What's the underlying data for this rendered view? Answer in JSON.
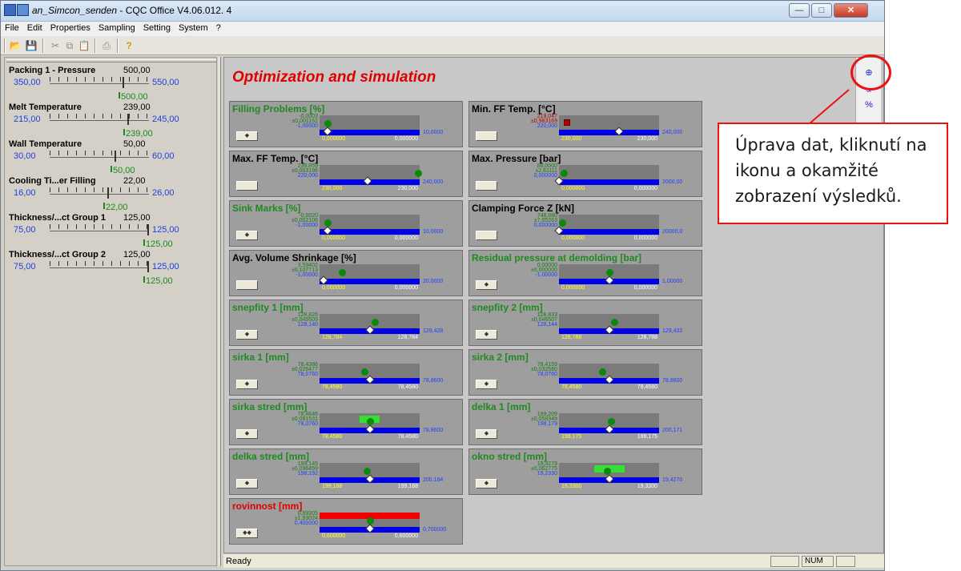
{
  "window": {
    "title_italic": "an_Simcon_senden",
    "title_rest": " - CQC Office V4.06.012. 4",
    "minimize": "—",
    "maximize": "□",
    "close": "✕"
  },
  "menu": [
    "File",
    "Edit",
    "Properties",
    "Sampling",
    "Setting",
    "System",
    "?"
  ],
  "toolbar_icons": [
    "open-folder-icon",
    "save-icon",
    "cut-icon",
    "copy-icon",
    "paste-icon",
    "print-icon",
    "help-icon"
  ],
  "params": [
    {
      "name": "Packing 1 - Pressure",
      "value": "500,00",
      "min": "350,00",
      "max": "550,00",
      "current": "500,00",
      "pos": 0.75
    },
    {
      "name": "Melt Temperature",
      "value": "239,00",
      "min": "215,00",
      "max": "245,00",
      "current": "239,00",
      "pos": 0.8
    },
    {
      "name": "Wall Temperature",
      "value": "50,00",
      "min": "30,00",
      "max": "60,00",
      "current": "50,00",
      "pos": 0.667
    },
    {
      "name": "Cooling Ti...er Filling",
      "value": "22,00",
      "min": "16,00",
      "max": "26,00",
      "current": "22,00",
      "pos": 0.6
    },
    {
      "name": "Thickness/...ct Group 1",
      "value": "125,00",
      "min": "75,00",
      "max": "125,00",
      "current": "125,00",
      "pos": 1.0
    },
    {
      "name": "Thickness/...ct Group 2",
      "value": "125,00",
      "min": "75,00",
      "max": "125,00",
      "current": "125,00",
      "pos": 1.0
    }
  ],
  "main": {
    "title": "Optimization and simulation"
  },
  "panels": [
    {
      "title": "Filling Problems [%]",
      "color": "#1f8a1f",
      "n1": "-0,0003",
      "n2": "±0,001152",
      "n3": "-1,00000",
      "lo": "0,000000",
      "hi": "0,000000",
      "mx": "10,0000",
      "dot": 0.08,
      "diam": 0.08,
      "marker": "dot",
      "btn": "◆"
    },
    {
      "title": "Min. FF Temp. [°C]",
      "color": "#000000",
      "n1": "219,047",
      "n2": "±0,983169",
      "n3": "220,000",
      "lo": "230,000",
      "hi": "230,000",
      "mx": "240,000",
      "dot": 0.08,
      "diam": 0.6,
      "marker": "sq",
      "red": true,
      "btn": ""
    },
    {
      "title": "Max. FF Temp. [°C]",
      "color": "#000000",
      "n1": "239,859",
      "n2": "±0,003196",
      "n3": "220,000",
      "lo": "230,000",
      "hi": "230,000",
      "mx": "240,000",
      "dot": 0.98,
      "diam": 0.48,
      "marker": "dot",
      "btn": ""
    },
    {
      "title": "Max. Pressure [bar]",
      "color": "#000000",
      "n1": "88,0000",
      "n2": "±2,61111",
      "n3": "0,000000",
      "lo": "0,000000",
      "hi": "0,000000",
      "mx": "2000,00",
      "dot": 0.05,
      "diam": 0.0,
      "marker": "dot",
      "btn": ""
    },
    {
      "title": "Sink Marks [%]",
      "color": "#1f8a1f",
      "n1": "-0,0020",
      "n2": "±0,002106",
      "n3": "-1,00000",
      "lo": "0,000000",
      "hi": "0,000000",
      "mx": "10,0000",
      "dot": 0.08,
      "diam": 0.08,
      "marker": "dot",
      "btn": "◆"
    },
    {
      "title": "Clamping Force Z [kN]",
      "color": "#000000",
      "n1": "748,880",
      "n2": "±7,05263",
      "n3": "0,000000",
      "lo": "0,000000",
      "hi": "0,000000",
      "mx": "20000,0",
      "dot": 0.03,
      "diam": 0.0,
      "marker": "dot",
      "btn": ""
    },
    {
      "title": "Avg. Volume Shrinkage [%]",
      "color": "#000000",
      "n1": "3,59402",
      "n2": "±0,107713",
      "n3": "-1,00000",
      "lo": "0,000000",
      "hi": "0,000000",
      "mx": "20,0000",
      "dot": 0.22,
      "diam": 0.04,
      "marker": "dot",
      "btn": ""
    },
    {
      "title": "Residual pressure at demolding [bar]",
      "color": "#1f8a1f",
      "n1": "0,00000",
      "n2": "±0,000000",
      "n3": "-1,00000",
      "lo": "0,000000",
      "hi": "0,000000",
      "mx": "1,00000",
      "dot": 0.5,
      "diam": 0.5,
      "marker": "dot",
      "btn": "◆"
    },
    {
      "title": "snepfity 1 [mm]",
      "color": "#1f8a1f",
      "n1": "128,826",
      "n2": "±0,045509",
      "n3": "128,140",
      "lo": "128,784",
      "hi": "128,784",
      "mx": "129,428",
      "dot": 0.55,
      "diam": 0.5,
      "marker": "dot",
      "btn": "◆"
    },
    {
      "title": "snepfity 2 [mm]",
      "color": "#1f8a1f",
      "n1": "128,833",
      "n2": "±0,046507",
      "n3": "128,144",
      "lo": "128,788",
      "hi": "128,788",
      "mx": "129,432",
      "dot": 0.55,
      "diam": 0.5,
      "marker": "dot",
      "btn": "◆"
    },
    {
      "title": "sirka 1 [mm]",
      "color": "#1f8a1f",
      "n1": "78,4386",
      "n2": "±0,026477",
      "n3": "78,0760",
      "lo": "78,4580",
      "hi": "78,4580",
      "mx": "78,8600",
      "dot": 0.45,
      "diam": 0.5,
      "marker": "dot",
      "btn": "◆"
    },
    {
      "title": "sirka 2 [mm]",
      "color": "#1f8a1f",
      "n1": "78,4159",
      "n2": "±0,032560",
      "n3": "78,0760",
      "lo": "78,4580",
      "hi": "78,4580",
      "mx": "78,8600",
      "dot": 0.43,
      "diam": 0.5,
      "marker": "dot",
      "btn": "◆"
    },
    {
      "title": "sirka stred [mm]",
      "color": "#1f8a1f",
      "n1": "78,4646",
      "n2": "±0,081531",
      "n3": "78,0760",
      "lo": "78,4580",
      "hi": "78,4580",
      "mx": "78,8600",
      "dot": 0.5,
      "diam": 0.5,
      "marker": "dot",
      "band": [
        0.4,
        0.6
      ],
      "btn": "◆"
    },
    {
      "title": "delka 1 [mm]",
      "color": "#1f8a1f",
      "n1": "199,209",
      "n2": "±0,058349",
      "n3": "198,179",
      "lo": "199,175",
      "hi": "199,175",
      "mx": "200,171",
      "dot": 0.52,
      "diam": 0.5,
      "marker": "dot",
      "btn": "◆"
    },
    {
      "title": "delka stred [mm]",
      "color": "#1f8a1f",
      "n1": "199,145",
      "n2": "±0,096459",
      "n3": "198,192",
      "lo": "199,188",
      "hi": "199,188",
      "mx": "200,184",
      "dot": 0.47,
      "diam": 0.5,
      "marker": "dot",
      "btn": "◆"
    },
    {
      "title": "okno stred [mm]",
      "color": "#1f8a1f",
      "n1": "19,3279",
      "n2": "±0,062775",
      "n3": "19,2330",
      "lo": "19,3300",
      "hi": "19,3300",
      "mx": "19,4270",
      "dot": 0.48,
      "diam": 0.5,
      "marker": "dot",
      "band": [
        0.35,
        0.65
      ],
      "btn": "◆"
    },
    {
      "title": "rovinnost [mm]",
      "color": "#e10000",
      "n1": "0,69305",
      "n2": "±1,93024",
      "n3": "0,400000",
      "lo": "0,600000",
      "hi": "0,600000",
      "mx": "0,700000",
      "dot": 0.5,
      "diam": 0.5,
      "marker": "dot",
      "redtop": true,
      "btn": "◆◆"
    }
  ],
  "right_strip_icons": [
    "crosshair-icon",
    "chart-icon",
    "percent-icon"
  ],
  "callout": {
    "text": "Úprava dat, kliknutí na ikonu a okamžité zobrazení výsledků."
  },
  "status": {
    "text": "Ready",
    "num": "NUM"
  }
}
